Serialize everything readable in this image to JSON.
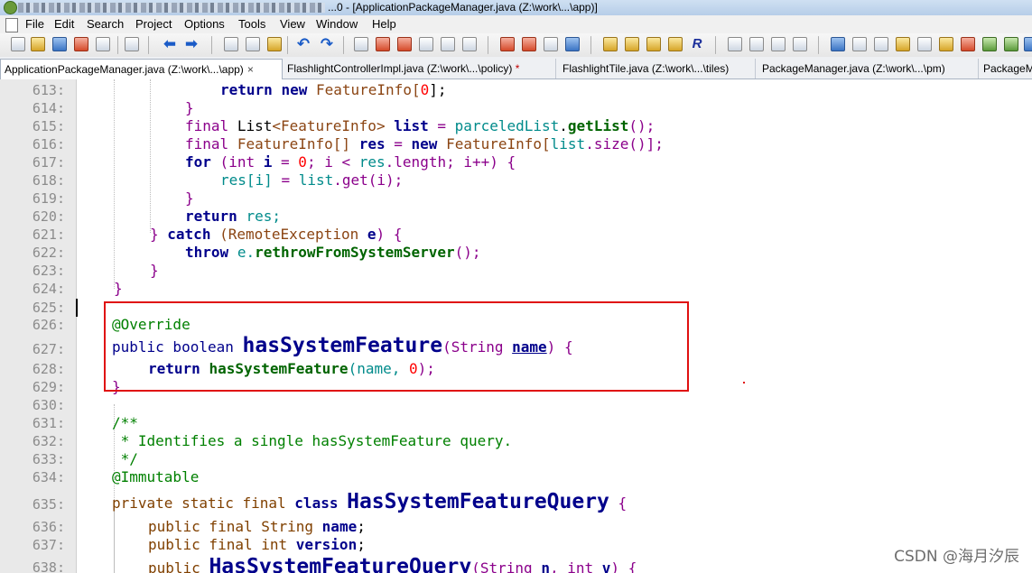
{
  "window": {
    "title": "...0 - [ApplicationPackageManager.java (Z:\\work\\...\\app)]"
  },
  "menu": [
    "File",
    "Edit",
    "Search",
    "Project",
    "Options",
    "Tools",
    "View",
    "Window",
    "Help"
  ],
  "tabs": [
    {
      "label": "ApplicationPackageManager.java (Z:\\work\\...\\app)",
      "active": true,
      "close": "×"
    },
    {
      "label": "FlashlightControllerImpl.java (Z:\\work\\...\\policy)",
      "modified": "*"
    },
    {
      "label": "FlashlightTile.java (Z:\\work\\...\\tiles)"
    },
    {
      "label": "PackageManager.java (Z:\\work\\...\\pm)"
    },
    {
      "label": "PackageM"
    }
  ],
  "line_numbers": [
    "613:",
    "614:",
    "615:",
    "616:",
    "617:",
    "618:",
    "619:",
    "620:",
    "621:",
    "622:",
    "623:",
    "624:",
    "625:",
    "626:",
    "627:",
    "628:",
    "629:",
    "630:",
    "631:",
    "632:",
    "633:",
    "634:",
    "635:",
    "636:",
    "637:",
    "638:"
  ],
  "code": {
    "l613": {
      "a": "return",
      "b": "new",
      "c": "FeatureInfo",
      "d": "[",
      "e": "0",
      "f": "];"
    },
    "l614": "}",
    "l615": {
      "a": "final",
      "b": "List",
      "c": "<FeatureInfo>",
      "d": "list",
      "e": "=",
      "f": "parceledList",
      "g": ".",
      "h": "getList",
      "i": "();"
    },
    "l616": {
      "a": "final",
      "b": "FeatureInfo[]",
      "c": "res",
      "d": "=",
      "e": "new",
      "f": "FeatureInfo[",
      "g": "list",
      "h": ".size()];"
    },
    "l617": {
      "a": "for",
      "b": "(",
      "c": "int",
      "d": "i",
      "e": "=",
      "f": "0",
      "g": "; i <",
      "h": "res",
      "i": ".length; i++) {"
    },
    "l618": {
      "a": "res[i]",
      "b": "=",
      "c": "list",
      "d": ".get(i);"
    },
    "l619": "}",
    "l620": {
      "a": "return",
      "b": "res;"
    },
    "l621": {
      "a": "}",
      "b": "catch",
      "c": "(RemoteException",
      "d": "e",
      "e": ") {"
    },
    "l622": {
      "a": "throw",
      "b": "e.",
      "c": "rethrowFromSystemServer",
      "d": "();"
    },
    "l623": "}",
    "l624": "}",
    "l626": "@Override",
    "l627": {
      "a": "public boolean",
      "b": "hasSystemFeature",
      "c": "(String",
      "d": "name",
      "e": ") {"
    },
    "l628": {
      "a": "return",
      "b": "hasSystemFeature",
      "c": "(name,",
      "d": "0",
      "e": ");"
    },
    "l629": "}",
    "l631": "/**",
    "l632": " * Identifies a single hasSystemFeature query.",
    "l633": " */",
    "l634": "@Immutable",
    "l635": {
      "a": "private static final",
      "b": "class",
      "c": "HasSystemFeatureQuery",
      "d": "{"
    },
    "l636": {
      "a": "public final String",
      "b": "name",
      "c": ";"
    },
    "l637": {
      "a": "public final int",
      "b": "version",
      "c": ";"
    },
    "l638": {
      "a": "public",
      "b": "HasSystemFeatureQuery",
      "c": "(String",
      "d": "n",
      "e": ",",
      "f": "int",
      "g": "v",
      "h": ") {"
    }
  },
  "watermark": "CSDN @海月汐辰",
  "colors": {
    "highlight_box": "#e01010",
    "keyword": "#00008b",
    "annotation": "#008000",
    "number": "#ff0000"
  }
}
